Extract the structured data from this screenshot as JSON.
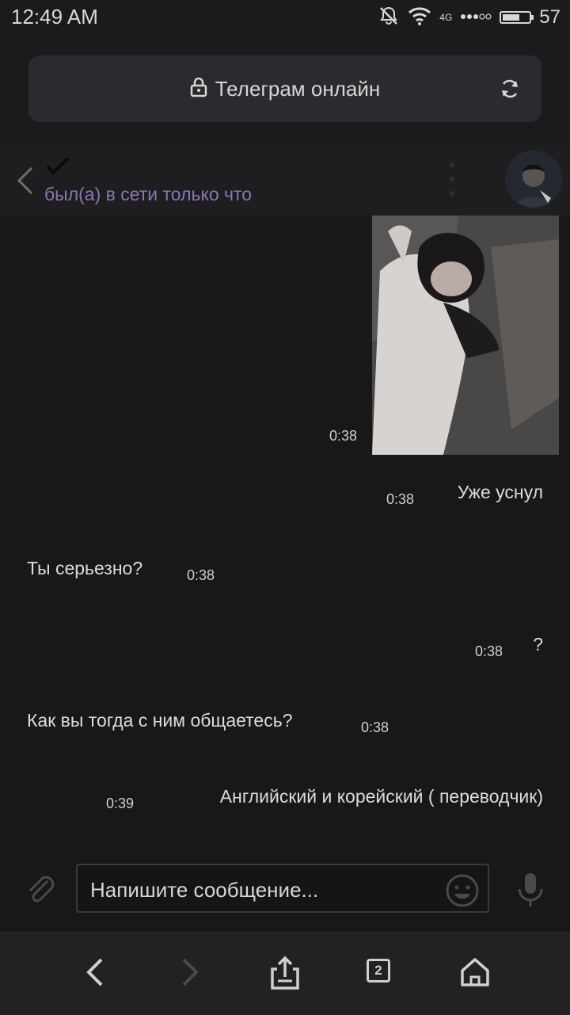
{
  "status_bar": {
    "time": "12:49 AM",
    "network": "4G",
    "battery": "57",
    "battery_level": 0.57,
    "icons": [
      "mute-icon",
      "wifi-icon",
      "signal-icon",
      "battery-icon"
    ]
  },
  "browser": {
    "page_title": "Телеграм онлайн",
    "lock_icon": "lock-icon",
    "reload_icon": "reload-icon"
  },
  "chat": {
    "contact_status": "был(а) в сети только что",
    "messages": [
      {
        "type": "photo",
        "time": "0:38"
      },
      {
        "type": "text",
        "text": "Уже уснул",
        "time": "0:38",
        "side": "out"
      },
      {
        "type": "text",
        "text": "Ты серьезно?",
        "time": "0:38",
        "side": "in"
      },
      {
        "type": "text",
        "text": "?",
        "time": "0:38",
        "side": "out"
      },
      {
        "type": "text",
        "text": "Как вы тогда с ним общаетесь?",
        "time": "0:38",
        "side": "in"
      },
      {
        "type": "text",
        "text": "Английский и корейский ( переводчик)",
        "time": "0:39",
        "side": "out"
      }
    ]
  },
  "compose": {
    "placeholder": "Напишите сообщение..."
  },
  "bottom_nav": {
    "tab_count": "2",
    "items": [
      "back-icon",
      "forward-icon",
      "share-icon",
      "tabs-icon",
      "home-icon"
    ]
  },
  "colors": {
    "background": "#181818",
    "status_accent": "#8e74b6",
    "text": "#dcdcdc"
  }
}
